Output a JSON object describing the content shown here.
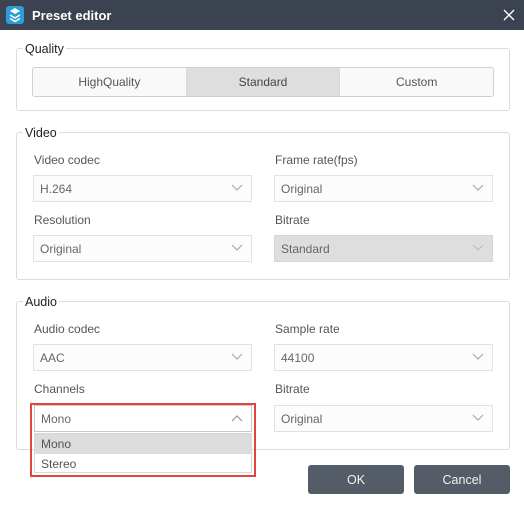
{
  "window": {
    "title": "Preset editor"
  },
  "quality": {
    "legend": "Quality",
    "options": [
      "HighQuality",
      "Standard",
      "Custom"
    ],
    "selected": "Standard"
  },
  "video": {
    "legend": "Video",
    "codec_label": "Video codec",
    "codec_value": "H.264",
    "framerate_label": "Frame rate(fps)",
    "framerate_value": "Original",
    "resolution_label": "Resolution",
    "resolution_value": "Original",
    "bitrate_label": "Bitrate",
    "bitrate_value": "Standard"
  },
  "audio": {
    "legend": "Audio",
    "codec_label": "Audio codec",
    "codec_value": "AAC",
    "samplerate_label": "Sample rate",
    "samplerate_value": "44100",
    "channels_label": "Channels",
    "channels_value": "Mono",
    "channels_options": [
      "Mono",
      "Stereo"
    ],
    "bitrate_label": "Bitrate",
    "bitrate_value": "Original"
  },
  "buttons": {
    "ok": "OK",
    "cancel": "Cancel"
  },
  "icons": {
    "app": "app-logo-icon",
    "close": "close-icon",
    "chevron_down": "chevron-down-icon",
    "chevron_up": "chevron-up-icon"
  },
  "colors": {
    "titlebar": "#3b4250",
    "button": "#545c68",
    "highlight": "#e0443c",
    "app_icon": "#2a9ed8"
  }
}
